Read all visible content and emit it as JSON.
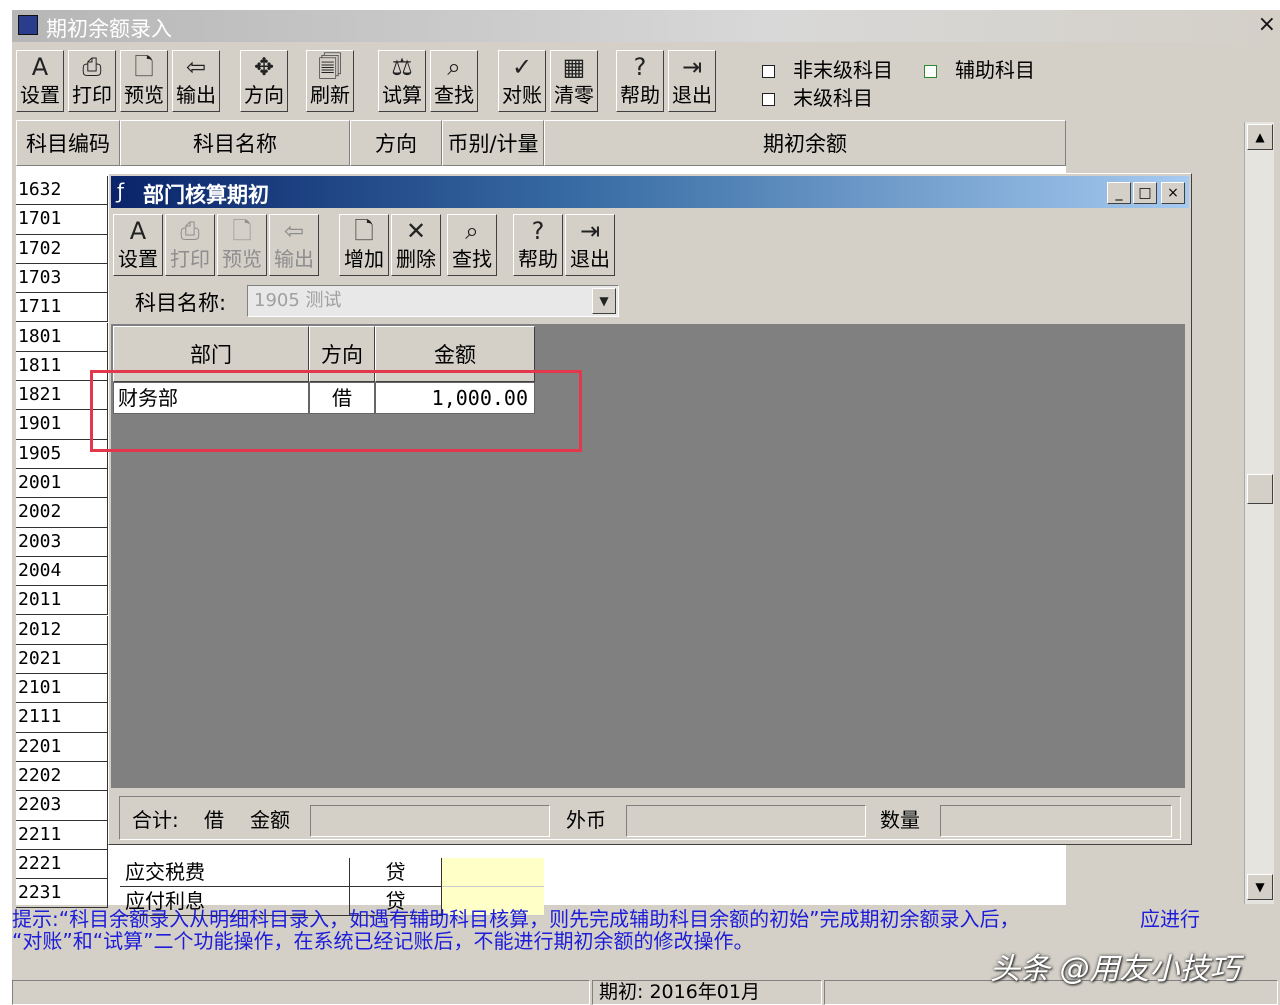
{
  "main_window": {
    "title": "期初余额录入",
    "close_glyph": "×",
    "toolbar": [
      {
        "label": "设置",
        "icon": "settings-icon",
        "glyph": "A"
      },
      {
        "label": "打印",
        "icon": "print-icon",
        "glyph": "⎙"
      },
      {
        "label": "预览",
        "icon": "preview-icon",
        "glyph": "🗋"
      },
      {
        "label": "输出",
        "icon": "export-icon",
        "glyph": "⇦"
      },
      {
        "label": "方向",
        "icon": "direction-icon",
        "glyph": "✥"
      },
      {
        "label": "刷新",
        "icon": "refresh-icon",
        "glyph": "🗐"
      },
      {
        "label": "试算",
        "icon": "trial-balance-icon",
        "glyph": "⚖"
      },
      {
        "label": "查找",
        "icon": "find-icon",
        "glyph": "⌕"
      },
      {
        "label": "对账",
        "icon": "reconcile-icon",
        "glyph": "✓"
      },
      {
        "label": "清零",
        "icon": "clear-icon",
        "glyph": "▦"
      },
      {
        "label": "帮助",
        "icon": "help-icon",
        "glyph": "?"
      },
      {
        "label": "退出",
        "icon": "exit-icon",
        "glyph": "⇥"
      }
    ],
    "options": {
      "non_leaf": "非末级科目",
      "auxiliary": "辅助科目",
      "leaf": "末级科目"
    }
  },
  "grid": {
    "headers": {
      "code": "科目编码",
      "name": "科目名称",
      "direction": "方向",
      "currency": "币别/计量",
      "balance": "期初余额"
    },
    "codes": [
      "1632",
      "1701",
      "1702",
      "1703",
      "1711",
      "1801",
      "1811",
      "1821",
      "1901",
      "1905",
      "2001",
      "2002",
      "2003",
      "2004",
      "2011",
      "2012",
      "2021",
      "2101",
      "2111",
      "2201",
      "2202",
      "2203",
      "2211",
      "2221",
      "2231"
    ],
    "visible_rows": [
      {
        "name": "应交税费",
        "direction": "贷"
      },
      {
        "name": "应付利息",
        "direction": "贷"
      }
    ]
  },
  "dialog": {
    "title": "部门核算期初",
    "window_buttons": [
      "_",
      "□",
      "×"
    ],
    "toolbar": [
      {
        "label": "设置",
        "icon": "settings-icon",
        "glyph": "A",
        "enabled": true
      },
      {
        "label": "打印",
        "icon": "print-icon",
        "glyph": "⎙",
        "enabled": false
      },
      {
        "label": "预览",
        "icon": "preview-icon",
        "glyph": "🗋",
        "enabled": false
      },
      {
        "label": "输出",
        "icon": "export-icon",
        "glyph": "⇦",
        "enabled": false
      },
      {
        "label": "增加",
        "icon": "add-icon",
        "glyph": "🗋",
        "enabled": true
      },
      {
        "label": "删除",
        "icon": "delete-icon",
        "glyph": "✕",
        "enabled": true
      },
      {
        "label": "查找",
        "icon": "find-icon",
        "glyph": "⌕",
        "enabled": true
      },
      {
        "label": "帮助",
        "icon": "help-icon",
        "glyph": "?",
        "enabled": true
      },
      {
        "label": "退出",
        "icon": "exit-icon",
        "glyph": "⇥",
        "enabled": true
      }
    ],
    "subject_label": "科目名称:",
    "subject_value": "1905 测试",
    "table": {
      "headers": {
        "dept": "部门",
        "direction": "方向",
        "amount": "金额"
      },
      "rows": [
        {
          "dept": "财务部",
          "direction": "借",
          "amount": "1,000.00"
        }
      ]
    },
    "totals": {
      "label": "合计:",
      "direction": "借",
      "amount_label": "金额",
      "fx_label": "外币",
      "qty_label": "数量"
    }
  },
  "hint": {
    "line1": "提示:“科目余额录入从明细科目录入，如遇有辅助科目核算，则先完成辅助科目余额的初始”完成期初余额录入后，",
    "line1_right": "应进行",
    "line2": "“对账”和“试算”二个功能操作，在系统已经记账后，不能进行期初余额的修改操作。"
  },
  "status": {
    "period": "期初: 2016年01月"
  },
  "watermark": "头条 @用友小技巧",
  "colors": {
    "highlight": "#e3384b",
    "hint_text": "#1d1dd9",
    "title_gradient_start": "#0a246a"
  }
}
